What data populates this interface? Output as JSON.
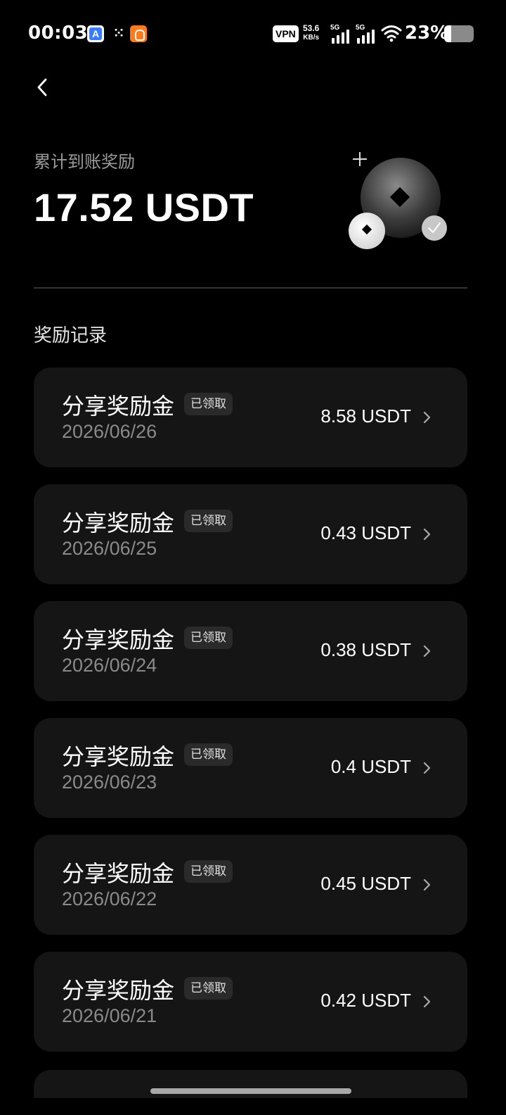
{
  "status_bar": {
    "time": "00:03",
    "app_icon_a": "A",
    "app_icon_x": "⁙",
    "vpn": "VPN",
    "speed_value": "53.6",
    "speed_unit": "KB/s",
    "sim1": "5G",
    "sim2": "5G",
    "battery_pct": "23%",
    "battery_level": 0.23
  },
  "header": {
    "total_label": "累计到账奖励",
    "total_amount": "17.52 USDT"
  },
  "section_title": "奖励记录",
  "records": [
    {
      "title": "分享奖励金",
      "status": "已领取",
      "date": "2026/06/26",
      "amount": "8.58 USDT"
    },
    {
      "title": "分享奖励金",
      "status": "已领取",
      "date": "2026/06/25",
      "amount": "0.43 USDT"
    },
    {
      "title": "分享奖励金",
      "status": "已领取",
      "date": "2026/06/24",
      "amount": "0.38 USDT"
    },
    {
      "title": "分享奖励金",
      "status": "已领取",
      "date": "2026/06/23",
      "amount": "0.4 USDT"
    },
    {
      "title": "分享奖励金",
      "status": "已领取",
      "date": "2026/06/22",
      "amount": "0.45 USDT"
    },
    {
      "title": "分享奖励金",
      "status": "已领取",
      "date": "2026/06/21",
      "amount": "0.42 USDT"
    }
  ],
  "colors": {
    "background": "#000000",
    "card": "#151515",
    "badge": "#2a2a2a",
    "muted_text": "#8a8a8a"
  },
  "icons": [
    "back-arrow-icon",
    "chevron-right-icon",
    "coin-icon",
    "checkmark-icon",
    "plus-icon",
    "wifi-icon",
    "battery-icon",
    "signal-icon"
  ]
}
